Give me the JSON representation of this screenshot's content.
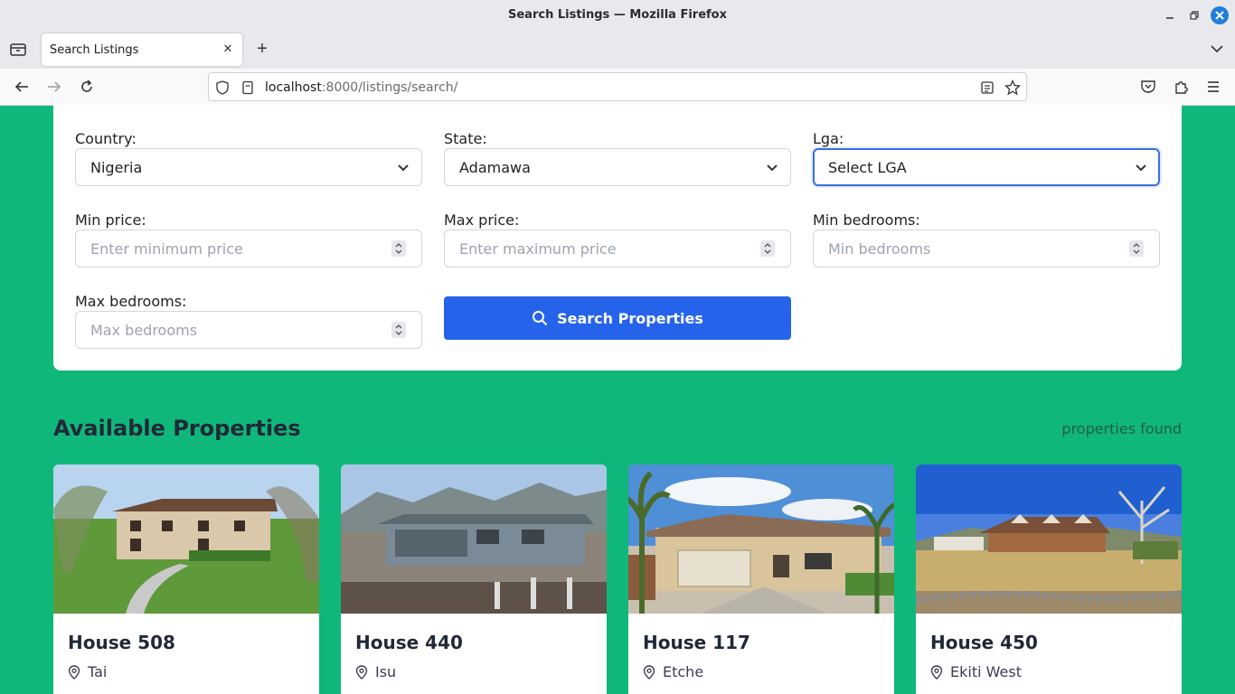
{
  "window": {
    "title": "Search Listings — Mozilla Firefox"
  },
  "tabs": [
    {
      "label": "Search Listings"
    }
  ],
  "url": {
    "host": "localhost",
    "rest": ":8000/listings/search/"
  },
  "filters": {
    "country": {
      "label": "Country:",
      "value": "Nigeria"
    },
    "state": {
      "label": "State:",
      "value": "Adamawa"
    },
    "lga": {
      "label": "Lga:",
      "value": "Select LGA"
    },
    "min_price": {
      "label": "Min price:",
      "placeholder": "Enter minimum price"
    },
    "max_price": {
      "label": "Max price:",
      "placeholder": "Enter maximum price"
    },
    "min_bedrooms": {
      "label": "Min bedrooms:",
      "placeholder": "Min bedrooms"
    },
    "max_bedrooms": {
      "label": "Max bedrooms:",
      "placeholder": "Max bedrooms"
    },
    "search_button": "Search Properties"
  },
  "results": {
    "title": "Available Properties",
    "count_text": "properties found",
    "listings": [
      {
        "name": "House 508",
        "location": "Tai"
      },
      {
        "name": "House 440",
        "location": "Isu"
      },
      {
        "name": "House 117",
        "location": "Etche"
      },
      {
        "name": "House 450",
        "location": "Ekiti West"
      }
    ]
  },
  "colors": {
    "page_bg": "#10b77a",
    "button_bg": "#2563eb",
    "focus_ring": "#3b6fe0"
  }
}
